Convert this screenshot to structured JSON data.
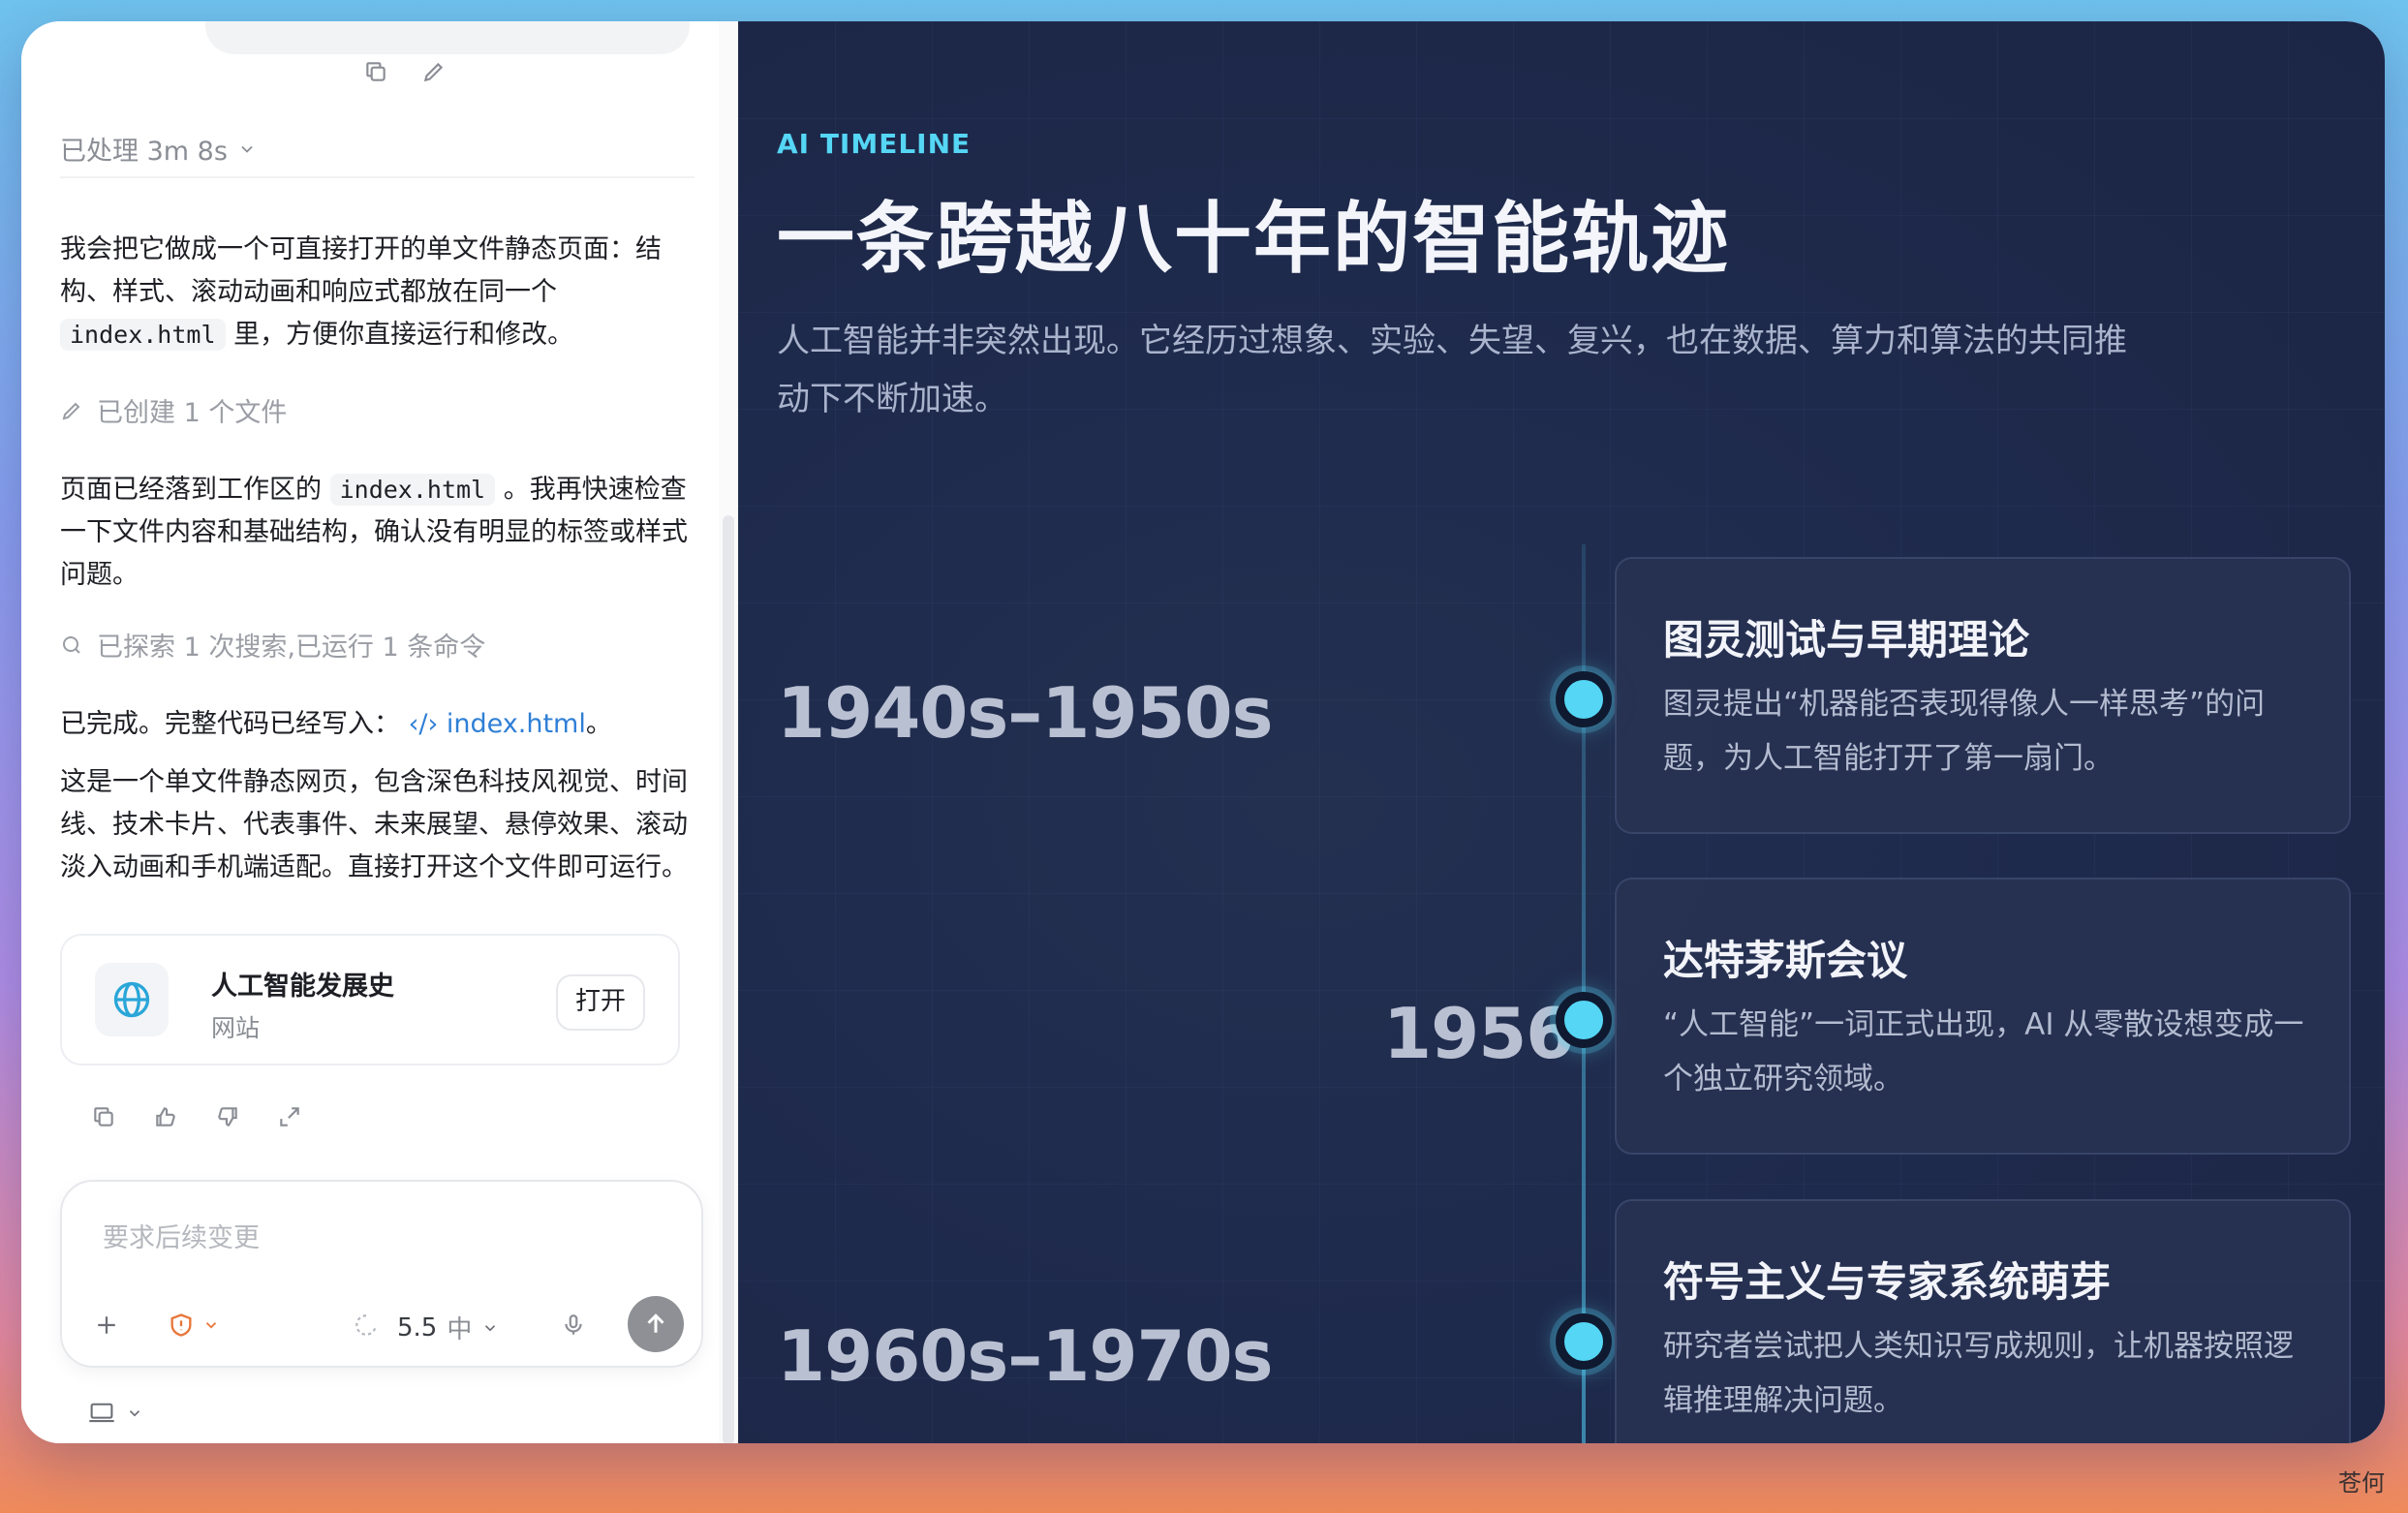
{
  "chat": {
    "processed": "已处理 3m 8s",
    "msg1_a": "我会把它做成一个可直接打开的单文件静态页面：结构、样式、滚动动画和响应式都放在同一个",
    "msg1_code": "index.html",
    "msg1_b": "里，方便你直接运行和修改。",
    "step_created": "已创建 1 个文件",
    "msg2_a": "页面已经落到工作区的",
    "msg2_code": "index.html",
    "msg2_b": "。我再快速检查一下文件内容和基础结构，确认没有明显的标签或样式问题。",
    "step_explored": "已探索 1 次搜索,已运行 1 条命令",
    "msg3_a": "已完成。完整代码已经写入：",
    "msg3_link": "index.html",
    "msg3_b": "。",
    "msg4": "这是一个单文件静态网页，包含深色科技风视觉、时间线、技术卡片、代表事件、未来展望、悬停效果、滚动淡入动画和手机端适配。直接打开这个文件即可运行。",
    "file_card": {
      "title": "人工智能发展史",
      "subtitle": "网站",
      "open_label": "打开"
    },
    "composer": {
      "placeholder": "要求后续变更",
      "model": "5.5",
      "level": "中"
    }
  },
  "preview": {
    "eyebrow": "AI TIMELINE",
    "title": "一条跨越八十年的智能轨迹",
    "subtitle": "人工智能并非突然出现。它经历过想象、实验、失望、复兴，也在数据、算力和算法的共同推动下不断加速。",
    "events": [
      {
        "year": "1940s–1950s",
        "title": "图灵测试与早期理论",
        "desc": "图灵提出“机器能否表现得像人一样思考”的问题，为人工智能打开了第一扇门。"
      },
      {
        "year": "1956",
        "title": "达特茅斯会议",
        "desc": "“人工智能”一词正式出现，AI 从零散设想变成一个独立研究领域。"
      },
      {
        "year": "1960s–1970s",
        "title": "符号主义与专家系统萌芽",
        "desc": "研究者尝试把人类知识写成规则，让机器按照逻辑推理解决问题。"
      }
    ]
  },
  "watermark": "苍何",
  "colors": {
    "accent": "#55d6f5",
    "preview_bg": "#1f2b4d",
    "link": "#2f7fd6"
  }
}
